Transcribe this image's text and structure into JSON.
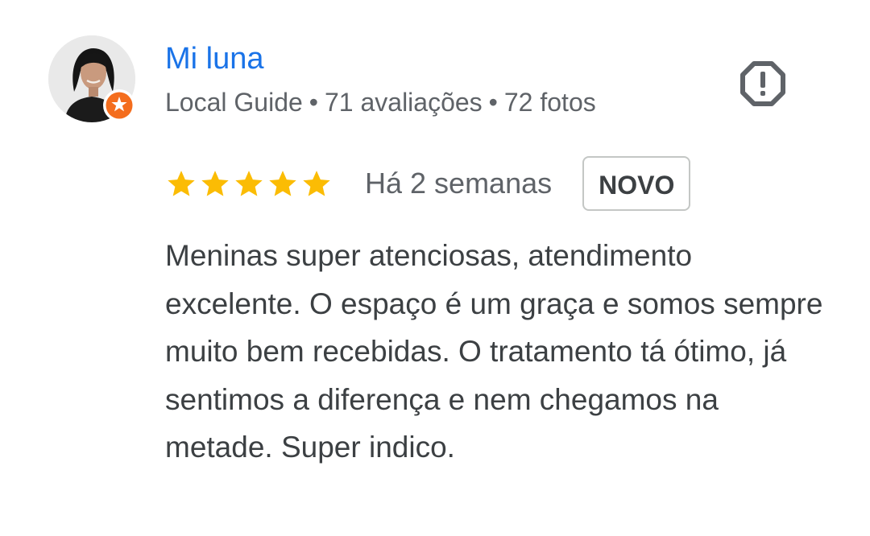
{
  "author": {
    "name": "Mi luna",
    "badge": "Local Guide",
    "reviews_count": "71 avaliações",
    "photos_count": "72 fotos",
    "separator": "•",
    "avatar_icon": "user-photo",
    "guide_badge_icon": "local-guide-star-badge"
  },
  "actions": {
    "report_icon": "report-octagon-icon"
  },
  "rating": {
    "stars": 5,
    "max_stars": 5,
    "star_color": "#fbbc04",
    "date": "Há 2 semanas",
    "new_badge": "NOVO"
  },
  "review": {
    "text": "Meninas super atenciosas, atendimento excelente. O espaço é um graça e somos sempre muito bem recebidas. O tratamento tá ótimo, já sentimos a diferença e nem chegamos na metade. Super indico."
  },
  "colors": {
    "name": "#1a73e8",
    "meta": "#5f6368",
    "body_text": "#3c4043",
    "badge_orange": "#f46d1d"
  }
}
